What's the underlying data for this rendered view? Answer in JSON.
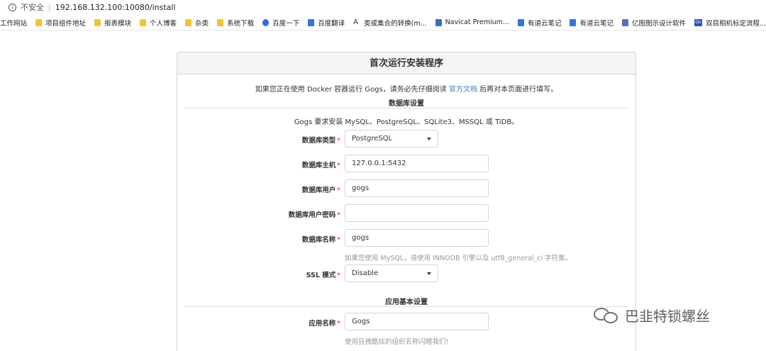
{
  "browser": {
    "security_label": "不安全",
    "url": "192.168.132.100:10080/install"
  },
  "bookmarks": [
    {
      "label": "工作网站",
      "icon": "none"
    },
    {
      "label": "项目组件地址",
      "icon": "folder-icon"
    },
    {
      "label": "报表模块",
      "icon": "folder-icon"
    },
    {
      "label": "个人博客",
      "icon": "folder-icon"
    },
    {
      "label": "杂类",
      "icon": "folder-icon"
    },
    {
      "label": "系统下载",
      "icon": "folder-icon"
    },
    {
      "label": "百度一下",
      "icon": "baidu-icon"
    },
    {
      "label": "百度翻译",
      "icon": "translate-icon"
    },
    {
      "label": "类或集合的转换(m...",
      "icon": "a-icon"
    },
    {
      "label": "Navicat Premium...",
      "icon": "navicat-icon"
    },
    {
      "label": "有道云笔记",
      "icon": "note-icon"
    },
    {
      "label": "有道云笔记",
      "icon": "note-icon"
    },
    {
      "label": "亿图图示设计软件",
      "icon": "yitu-icon"
    },
    {
      "label": "双目相机标定流程...",
      "icon": "on-icon"
    }
  ],
  "panel": {
    "title": "首次运行安装程序",
    "notice_prefix": "如果您正在使用 Docker 容器运行 Gogs，请务必先仔细阅读",
    "notice_link": "官方文档",
    "notice_suffix": "后再对本页面进行填写。"
  },
  "db": {
    "section_title": "数据库设置",
    "description": "Gogs 要求安装 MySQL、PostgreSQL、SQLite3、MSSQL 或 TiDB。",
    "type_label": "数据库类型",
    "type_value": "PostgreSQL",
    "host_label": "数据库主机",
    "host_value": "127.0.0.1:5432",
    "user_label": "数据库用户",
    "user_value": "gogs",
    "password_label": "数据库用户密码",
    "password_value": "",
    "name_label": "数据库名称",
    "name_value": "gogs",
    "name_help": "如果您使用 MySQL，请使用 INNODB 引擎以及 utf8_general_ci 字符集。",
    "ssl_label": "SSL 模式",
    "ssl_value": "Disable"
  },
  "app": {
    "section_title": "应用基本设置",
    "name_label": "应用名称",
    "name_value": "Gogs",
    "name_help": "使用狂拽酷炫的组织名称闪瞎我们!"
  },
  "required_mark": "*",
  "watermark": "巴韭特锁螺丝",
  "colors": {
    "link": "#4183c4",
    "required": "#db2828",
    "header_bg": "#f3f4f5"
  }
}
